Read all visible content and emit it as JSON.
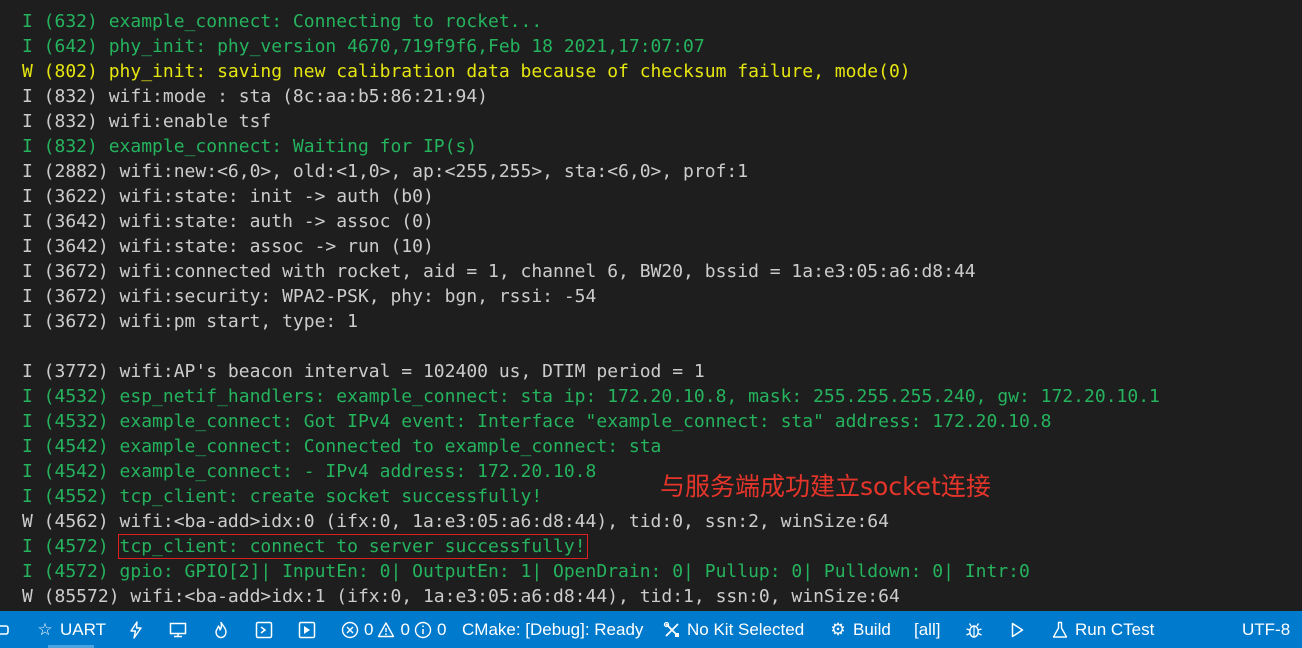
{
  "terminal": {
    "lines": [
      {
        "text": "I (632) example_connect: Connecting to rocket...",
        "level": "info"
      },
      {
        "text": "I (642) phy_init: phy_version 4670,719f9f6,Feb 18 2021,17:07:07",
        "level": "info"
      },
      {
        "text": "W (802) phy_init: saving new calibration data because of checksum failure, mode(0)",
        "level": "warn"
      },
      {
        "text": "I (832) wifi:mode : sta (8c:aa:b5:86:21:94)",
        "level": "plain"
      },
      {
        "text": "I (832) wifi:enable tsf",
        "level": "plain"
      },
      {
        "text": "I (832) example_connect: Waiting for IP(s)",
        "level": "info"
      },
      {
        "text": "I (2882) wifi:new:<6,0>, old:<1,0>, ap:<255,255>, sta:<6,0>, prof:1",
        "level": "plain"
      },
      {
        "text": "I (3622) wifi:state: init -> auth (b0)",
        "level": "plain"
      },
      {
        "text": "I (3642) wifi:state: auth -> assoc (0)",
        "level": "plain"
      },
      {
        "text": "I (3642) wifi:state: assoc -> run (10)",
        "level": "plain"
      },
      {
        "text": "I (3672) wifi:connected with rocket, aid = 1, channel 6, BW20, bssid = 1a:e3:05:a6:d8:44",
        "level": "plain"
      },
      {
        "text": "I (3672) wifi:security: WPA2-PSK, phy: bgn, rssi: -54",
        "level": "plain"
      },
      {
        "text": "I (3672) wifi:pm start, type: 1",
        "level": "plain"
      },
      {
        "text": "",
        "level": "plain"
      },
      {
        "text": "I (3772) wifi:AP's beacon interval = 102400 us, DTIM period = 1",
        "level": "plain"
      },
      {
        "text": "I (4532) esp_netif_handlers: example_connect: sta ip: 172.20.10.8, mask: 255.255.255.240, gw: 172.20.10.1",
        "level": "info"
      },
      {
        "text": "I (4532) example_connect: Got IPv4 event: Interface \"example_connect: sta\" address: 172.20.10.8",
        "level": "info"
      },
      {
        "text": "I (4542) example_connect: Connected to example_connect: sta",
        "level": "info"
      },
      {
        "text": "I (4542) example_connect: - IPv4 address: 172.20.10.8",
        "level": "info"
      },
      {
        "text": "I (4552) tcp_client: create socket successfully!",
        "level": "info"
      },
      {
        "text": "W (4562) wifi:<ba-add>idx:0 (ifx:0, 1a:e3:05:a6:d8:44), tid:0, ssn:2, winSize:64",
        "level": "plain"
      },
      {
        "prefix": "I (4572) ",
        "text": "tcp_client: connect to server successfully!",
        "level": "info",
        "boxed": true
      },
      {
        "text": "I (4572) gpio: GPIO[2]| InputEn: 0| OutputEn: 1| OpenDrain: 0| Pullup: 0| Pulldown: 0| Intr:0",
        "level": "info"
      },
      {
        "text": "W (85572) wifi:<ba-add>idx:1 (ifx:0, 1a:e3:05:a6:d8:44), tid:1, ssn:0, winSize:64",
        "level": "plain"
      }
    ],
    "annotation": "与服务端成功建立socket连接"
  },
  "colors": {
    "background": "#1e1e1e",
    "info": "#25b35e",
    "plain": "#cccccc",
    "warn": "#e5e510",
    "highlight_box": "#e02020",
    "annotation": "#e5352b",
    "statusbar": "#007acc"
  },
  "statusbar": {
    "uart_label": "UART",
    "errors_count": "0",
    "warnings_count": "0",
    "info_count": "0",
    "cmake_label": "CMake: [Debug]: Ready",
    "kit_label": "No Kit Selected",
    "build_label": "Build",
    "target_label": "[all]",
    "ctest_label": "Run CTest",
    "encoding_label": "UTF-8",
    "icons": [
      "remote-icon",
      "star-icon",
      "flash-icon",
      "monitor-icon",
      "flame-icon",
      "terminal-icon",
      "debug-console-icon",
      "error-icon",
      "warning-icon",
      "info-icon",
      "tools-icon",
      "gear-icon",
      "bug-icon",
      "play-icon",
      "flask-icon"
    ]
  }
}
